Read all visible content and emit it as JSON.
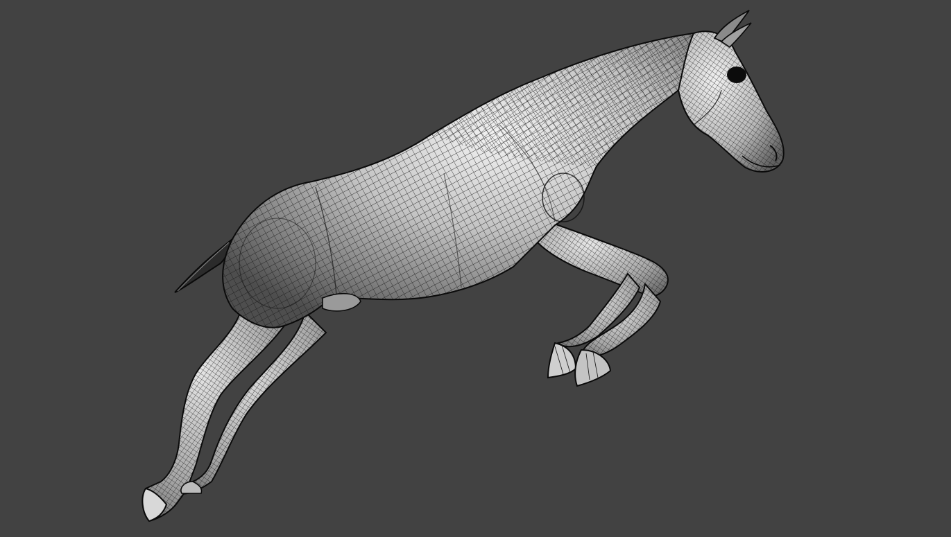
{
  "viewport": {
    "background_color": "#424242",
    "subject": "horse-wireframe-model",
    "mesh_fill_light": "#e8e8e8",
    "mesh_fill_mid": "#9a9a9a",
    "mesh_fill_dark": "#5a5a5a",
    "wire_color": "#141414",
    "outline_color": "#0a0a0a"
  }
}
